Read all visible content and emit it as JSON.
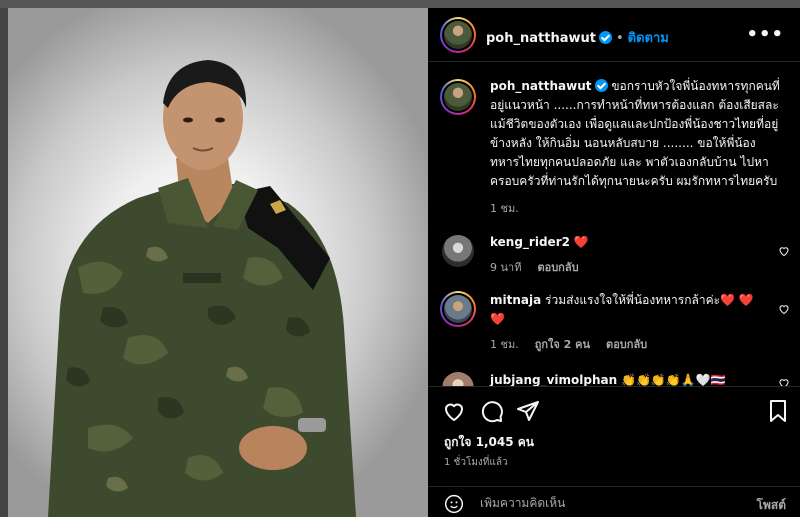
{
  "post_header": {
    "username": "poh_natthawut",
    "separator": "•",
    "follow_label": "ติดตาม",
    "more_icon": "more-horizontal-icon"
  },
  "caption": {
    "username": "poh_natthawut",
    "text": "ขอกราบหัวใจพี่น้องทหารทุกคนที่อยู่แนวหน้า ......การทำหน้าที่ทหารต้องแลก ต้องเสียสละ แม้ชีวิตของตัวเอง เพื่อดูแลและปกป้องพี่น้องชาวไทยที่อยู่ข้างหลัง ให้กินอิ่ม นอนหลับสบาย ........ ขอให้พี่น้องทหารไทยทุกคนปลอดภัย และ พาตัวเองกลับบ้าน ไปหาครอบครัวที่ท่านรักได้ทุกนายนะครับ ผมรักทหารไทยครับ",
    "time": "1 ชม."
  },
  "comments": [
    {
      "username": "keng_rider2",
      "text": "❤️",
      "time": "9 นาที",
      "likes": "",
      "reply_label": "ตอบกลับ"
    },
    {
      "username": "mitnaja",
      "text": "ร่วมส่งแรงใจให้พี่น้องทหารกล้าค่ะ❤️ ❤️ ❤️",
      "time": "1 ชม.",
      "likes": "ถูกใจ 2 คน",
      "reply_label": "ตอบกลับ"
    },
    {
      "username": "jubjang_vimolphan",
      "text": "👏👏👏👏🙏🤍🇹🇭",
      "time": "",
      "likes": "",
      "reply_label": ""
    }
  ],
  "actions": {
    "likes_text": "ถูกใจ 1,045 คน",
    "time_ago": "1 ชั่วโมงที่แล้ว"
  },
  "add_comment": {
    "placeholder": "เพิ่มความคิดเห็น",
    "post_label": "โพสต์"
  },
  "colors": {
    "accent": "#0095f6",
    "heart": "#ff3040",
    "panel_bg": "#000000",
    "muted": "#a8a8a8"
  }
}
